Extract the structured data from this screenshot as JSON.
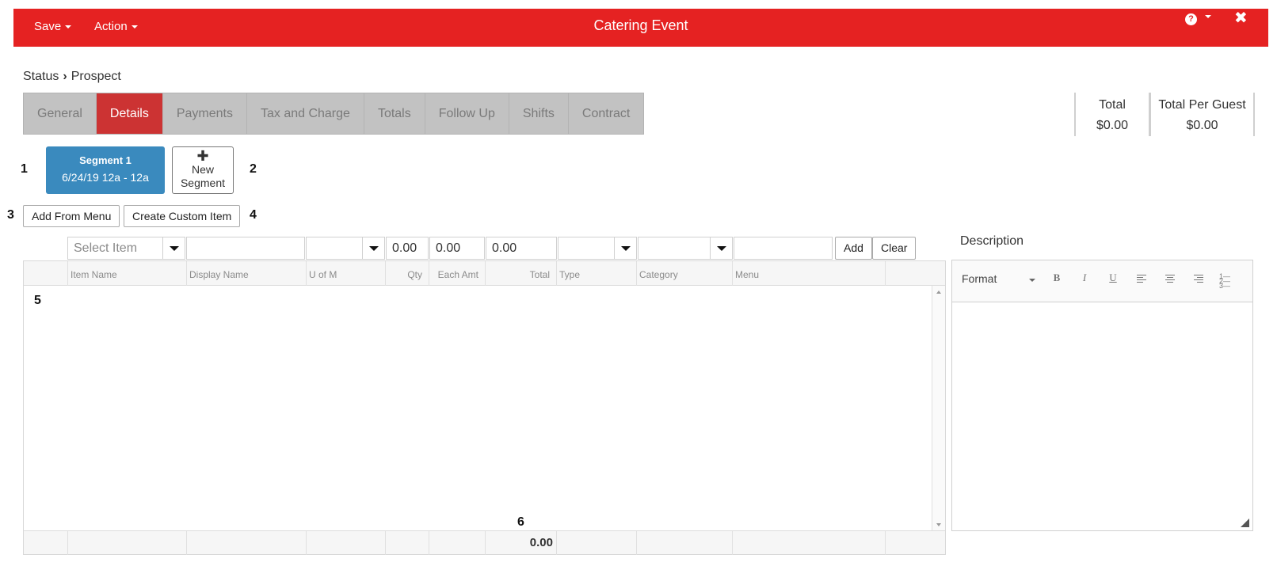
{
  "header": {
    "title": "Catering Event",
    "save_label": "Save",
    "action_label": "Action",
    "help_icon": "?",
    "close_icon": "✖"
  },
  "status": {
    "label": "Status",
    "value": "Prospect"
  },
  "tabs": [
    "General",
    "Details",
    "Payments",
    "Tax and Charge",
    "Totals",
    "Follow Up",
    "Shifts",
    "Contract"
  ],
  "active_tab": "Details",
  "totals": {
    "total_label": "Total",
    "total_value": "$0.00",
    "per_guest_label": "Total Per Guest",
    "per_guest_value": "$0.00"
  },
  "segments": {
    "current_name": "Segment 1",
    "current_time": "6/24/19 12a - 12a",
    "new_label_1": "New",
    "new_label_2": "Segment"
  },
  "buttons": {
    "add_from_menu": "Add From Menu",
    "create_custom_item": "Create Custom Item",
    "add": "Add",
    "clear": "Clear"
  },
  "filter": {
    "select_item_placeholder": "Select Item",
    "qty": "0.00",
    "each_amt": "0.00",
    "total": "0.00"
  },
  "grid": {
    "columns": [
      "Item Name",
      "Display Name",
      "U of M",
      "Qty",
      "Each Amt",
      "Total",
      "Type",
      "Category",
      "Menu"
    ],
    "footer_total": "0.00"
  },
  "description": {
    "label": "Description",
    "format_label": "Format"
  },
  "callouts": [
    "1",
    "2",
    "3",
    "4",
    "5",
    "6"
  ],
  "colors": {
    "header_red": "#e52222",
    "active_tab": "#cc3333",
    "segment_blue": "#3a8abe"
  },
  "icons": [
    "chevron-right-icon",
    "plus-icon",
    "help-icon",
    "close-icon",
    "bold-icon",
    "italic-icon",
    "underline-icon",
    "align-left-icon",
    "align-center-icon",
    "align-right-icon",
    "ordered-list-icon",
    "resize-icon"
  ]
}
